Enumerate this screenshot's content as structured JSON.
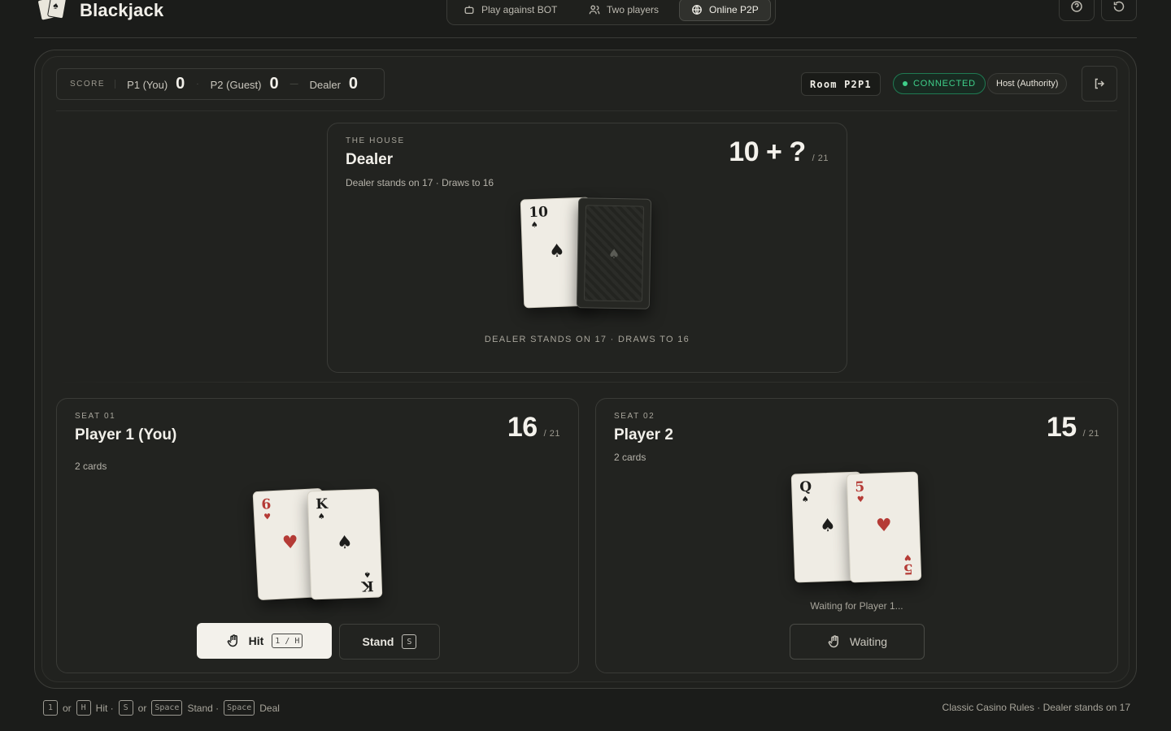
{
  "app": {
    "title": "Blackjack"
  },
  "modes": [
    {
      "label": "Play against BOT",
      "icon": "bot-icon"
    },
    {
      "label": "Two players",
      "icon": "users-icon"
    },
    {
      "label": "Online P2P",
      "icon": "globe-icon",
      "active": true
    }
  ],
  "score": {
    "label": "SCORE",
    "p1_label": "P1 (You)",
    "p1_value": "0",
    "p2_label": "P2 (Guest)",
    "p2_value": "0",
    "dealer_label": "Dealer",
    "dealer_value": "0"
  },
  "room": {
    "label": "Room P2P1",
    "status": "CONNECTED",
    "role": "Host (Authority)"
  },
  "dealer": {
    "eyebrow": "THE HOUSE",
    "name": "Dealer",
    "sub": "Dealer stands on 17 · Draws to 16",
    "total": "10 + ?",
    "max": "/ 21",
    "footer": "DEALER STANDS ON 17 · DRAWS TO 16",
    "cards": [
      {
        "rank": "10",
        "suit": "♠",
        "color": "black"
      },
      {
        "hidden": true,
        "mark": "♠"
      }
    ]
  },
  "player1": {
    "eyebrow": "SEAT 01",
    "name": "Player 1 (You)",
    "sub": "2 cards",
    "total": "16",
    "max": "/ 21",
    "cards": [
      {
        "rank": "6",
        "suit": "♥",
        "color": "red"
      },
      {
        "rank": "K",
        "suit": "♠",
        "color": "black"
      }
    ],
    "hit_label": "Hit",
    "hit_kbd": "1 / H",
    "stand_label": "Stand",
    "stand_kbd": "S"
  },
  "player2": {
    "eyebrow": "SEAT 02",
    "name": "Player 2",
    "sub": "2 cards",
    "total": "15",
    "max": "/ 21",
    "cards": [
      {
        "rank": "Q",
        "suit": "♠",
        "color": "black"
      },
      {
        "rank": "5",
        "suit": "♥",
        "color": "red"
      }
    ],
    "waiting_note": "Waiting for Player 1...",
    "waiting_label": "Waiting"
  },
  "footer": {
    "k1": "1",
    "or1": "or",
    "k2": "H",
    "hit": "Hit ·",
    "k3": "S",
    "or2": "or",
    "k4": "Space",
    "stand": "Stand ·",
    "k5": "Space",
    "deal": "Deal",
    "rules": "Classic Casino Rules · Dealer stands on 17"
  },
  "colors": {
    "connected": "#3fd08a",
    "red_suit": "#b53b36",
    "background": "#1b1c1a"
  }
}
